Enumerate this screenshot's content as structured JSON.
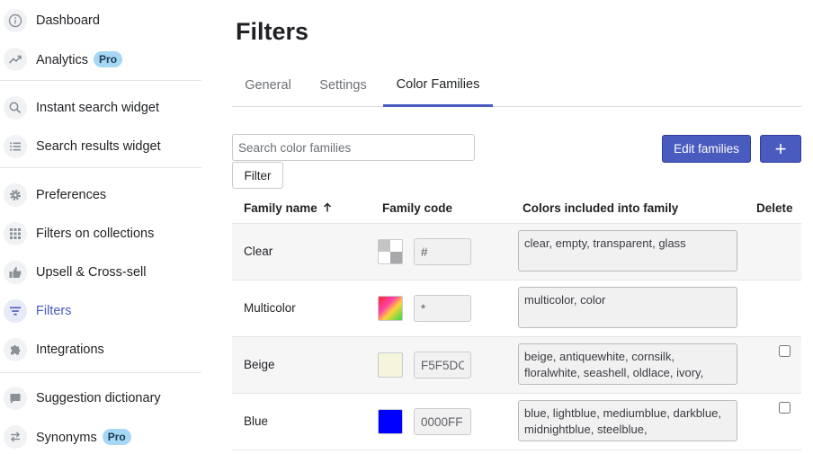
{
  "sidebar": {
    "items": [
      {
        "label": "Dashboard",
        "icon": "info-icon",
        "pro": false
      },
      {
        "label": "Analytics",
        "icon": "trend-icon",
        "pro": true
      },
      {
        "label": "Instant search widget",
        "icon": "search-icon",
        "pro": false
      },
      {
        "label": "Search results widget",
        "icon": "list-icon",
        "pro": false
      },
      {
        "label": "Preferences",
        "icon": "gear-icon",
        "pro": false
      },
      {
        "label": "Filters on collections",
        "icon": "grid-icon",
        "pro": false
      },
      {
        "label": "Upsell & Cross-sell",
        "icon": "thumbs-up-icon",
        "pro": false
      },
      {
        "label": "Filters",
        "icon": "filter-icon",
        "pro": false,
        "active": true
      },
      {
        "label": "Integrations",
        "icon": "puzzle-icon",
        "pro": false
      },
      {
        "label": "Suggestion dictionary",
        "icon": "chat-icon",
        "pro": false
      },
      {
        "label": "Synonyms",
        "icon": "swap-icon",
        "pro": true
      }
    ],
    "pro_badge": "Pro"
  },
  "page": {
    "title": "Filters"
  },
  "tabs": [
    {
      "label": "General",
      "active": false
    },
    {
      "label": "Settings",
      "active": false
    },
    {
      "label": "Color Families",
      "active": true
    }
  ],
  "toolbar": {
    "search_placeholder": "Search color families",
    "filter_label": "Filter",
    "edit_label": "Edit families",
    "add_label": "+"
  },
  "table": {
    "headers": {
      "name": "Family name",
      "code": "Family code",
      "colors": "Colors included into family",
      "delete": "Delete"
    },
    "rows": [
      {
        "name": "Clear",
        "code": "#",
        "colors": "clear, empty, transparent, glass",
        "swatch": "checker",
        "deletable": false
      },
      {
        "name": "Multicolor",
        "code": "*",
        "colors": "multicolor, color",
        "swatch": "rainbow",
        "deletable": false
      },
      {
        "name": "Beige",
        "code": "F5F5DC",
        "colors": "beige, antiquewhite, cornsilk, floralwhite, seashell, oldlace, ivory,",
        "swatch": "#F5F5DC",
        "deletable": true
      },
      {
        "name": "Blue",
        "code": "0000FF",
        "colors": "blue, lightblue, mediumblue, darkblue, midnightblue, steelblue,",
        "swatch": "#0000FF",
        "deletable": true
      }
    ]
  },
  "colors": {
    "accent": "#4a5bbf",
    "accent_dark": "#2f3d9a",
    "badge": "#a6d8f5"
  }
}
